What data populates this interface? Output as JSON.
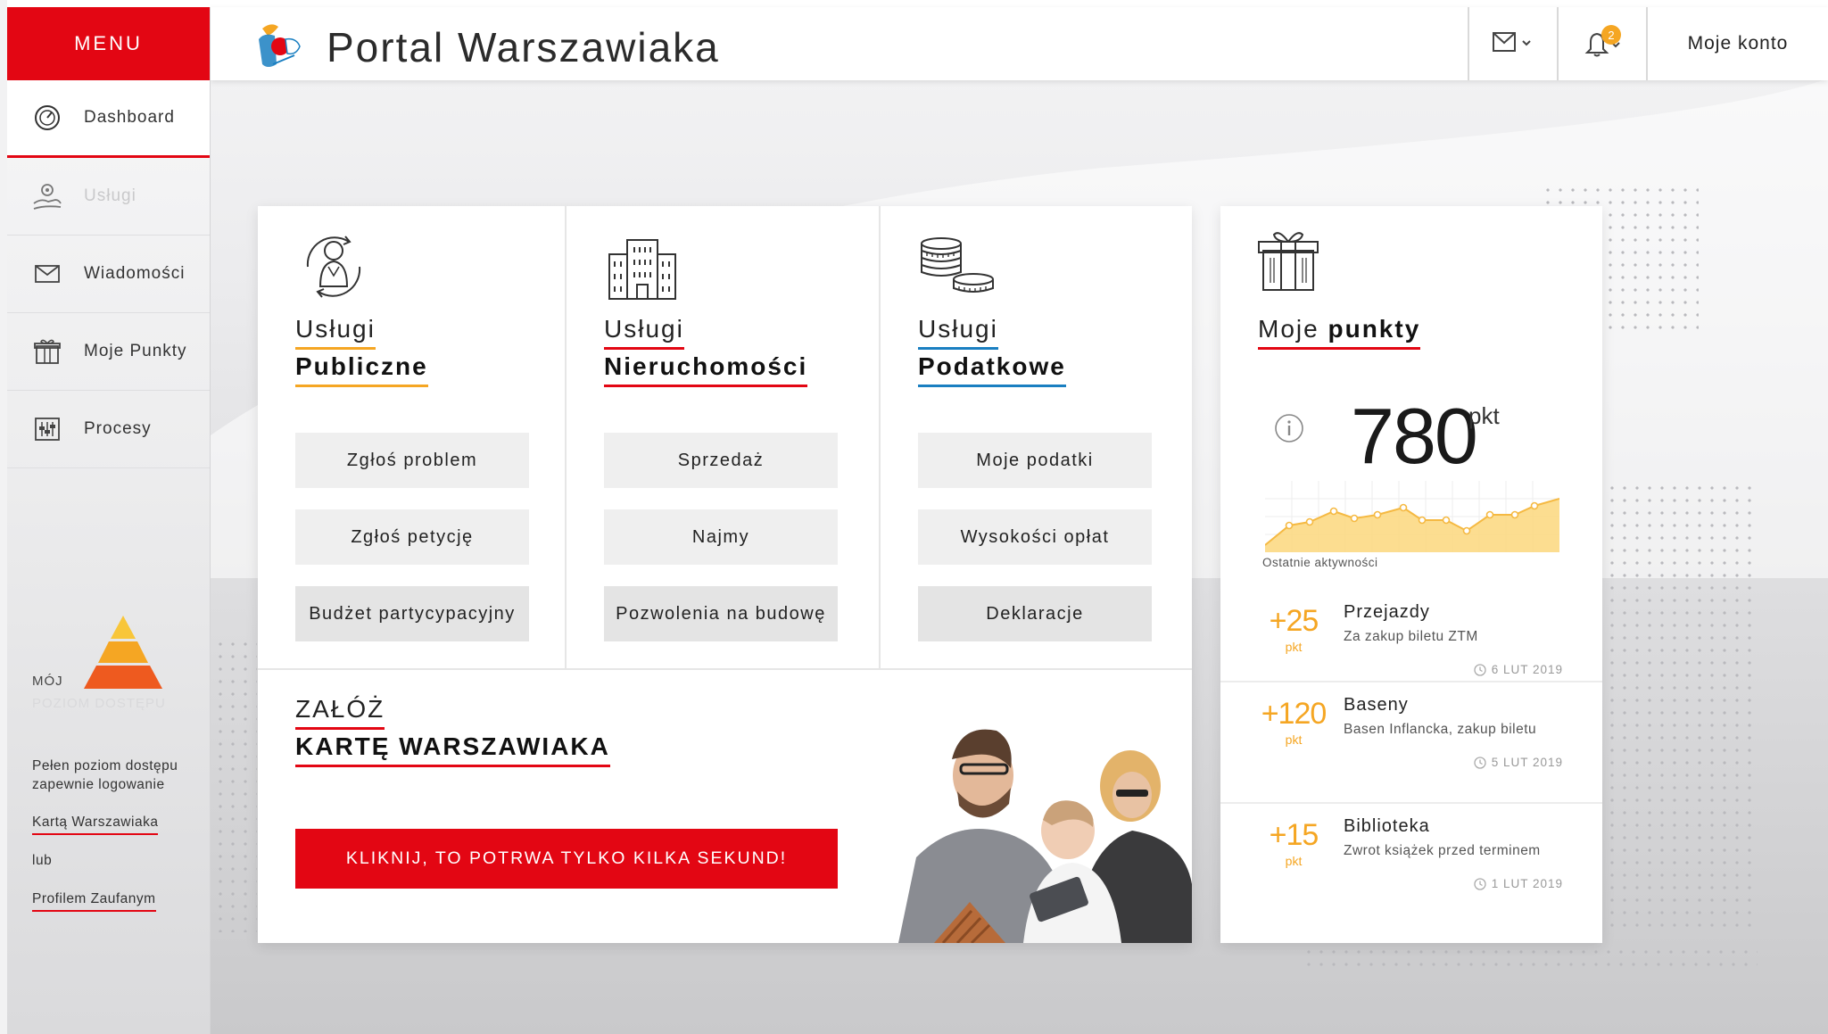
{
  "app": {
    "title": "Portal Warszawiaka"
  },
  "colors": {
    "brand_red": "#e30613",
    "accent_orange": "#f5a623",
    "accent_blue": "#1a7fc1"
  },
  "sidebar": {
    "menu_label": "MENU",
    "items": [
      {
        "label": "Dashboard",
        "icon": "dashboard-icon",
        "active": true
      },
      {
        "label": "Usługi",
        "icon": "services-icon",
        "disabled": true
      },
      {
        "label": "Wiadomości",
        "icon": "envelope-icon"
      },
      {
        "label": "Moje Punkty",
        "icon": "gift-icon"
      },
      {
        "label": "Procesy",
        "icon": "process-icon"
      }
    ],
    "access": {
      "moj": "MÓJ",
      "poziom": "POZIOM DOSTĘPU",
      "info": "Pełen poziom dostępu zapewnie logowanie",
      "link1": "Kartą Warszawiaka",
      "or": "lub",
      "link2": "Profilem Zaufanym"
    }
  },
  "header": {
    "mail_icon": "envelope-icon",
    "bell_icon": "bell-icon",
    "notifications_count": "2",
    "account_label": "Moje konto"
  },
  "services": {
    "columns": [
      {
        "title1": "Usługi",
        "title2": "Publiczne",
        "icon": "citizen-icon",
        "buttons": [
          "Zgłoś problem",
          "Zgłoś petycję",
          "Budżet partycypacyjny"
        ]
      },
      {
        "title1": "Usługi",
        "title2": "Nieruchomości",
        "icon": "building-icon",
        "buttons": [
          "Sprzedaż",
          "Najmy",
          "Pozwolenia na budowę"
        ]
      },
      {
        "title1": "Usługi",
        "title2": "Podatkowe",
        "icon": "coins-icon",
        "buttons": [
          "Moje podatki",
          "Wysokości opłat",
          "Deklaracje"
        ]
      }
    ],
    "karta": {
      "title1": "ZAŁÓŻ",
      "title2": "KARTĘ WARSZAWIAKA",
      "cta": "KLIKNIJ, TO POTRWA TYLKO KILKA SEKUND!"
    }
  },
  "points": {
    "title_normal": "Moje",
    "title_bold": "punkty",
    "total": "780",
    "unit": "pkt",
    "chart_caption": "Ostatnie aktywności",
    "activities": [
      {
        "points": "+25",
        "unit": "pkt",
        "name": "Przejazdy",
        "desc": "Za zakup biletu ZTM",
        "date": "6 LUT 2019"
      },
      {
        "points": "+120",
        "unit": "pkt",
        "name": "Baseny",
        "desc": "Basen Inflancka, zakup biletu",
        "date": "5 LUT 2019"
      },
      {
        "points": "+15",
        "unit": "pkt",
        "name": "Biblioteka",
        "desc": "Zwrot książek przed terminem",
        "date": "1 LUT 2019"
      }
    ]
  }
}
